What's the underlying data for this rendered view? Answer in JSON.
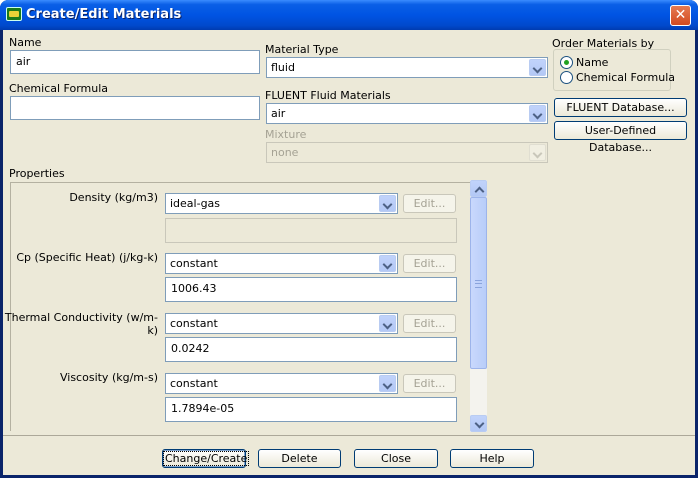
{
  "window": {
    "title": "Create/Edit Materials",
    "close_glyph": "✕"
  },
  "name": {
    "label": "Name",
    "value": "air"
  },
  "chemical_formula": {
    "label": "Chemical Formula",
    "value": ""
  },
  "material_type": {
    "label": "Material Type",
    "value": "fluid"
  },
  "fluent_fluid_materials": {
    "label": "FLUENT Fluid Materials",
    "value": "air"
  },
  "mixture": {
    "label": "Mixture",
    "value": "none"
  },
  "order_materials": {
    "label": "Order Materials by",
    "options": [
      {
        "label": "Name",
        "selected": true
      },
      {
        "label": "Chemical Formula",
        "selected": false
      }
    ]
  },
  "database_buttons": {
    "fluent": "FLUENT Database...",
    "user_defined": "User-Defined Database..."
  },
  "properties": {
    "label": "Properties",
    "edit_label": "Edit...",
    "items": [
      {
        "label": "Density (kg/m3)",
        "method": "ideal-gas",
        "value": ""
      },
      {
        "label": "Cp (Specific Heat) (j/kg-k)",
        "method": "constant",
        "value": "1006.43"
      },
      {
        "label": "Thermal Conductivity (w/m-k)",
        "method": "constant",
        "value": "0.0242"
      },
      {
        "label": "Viscosity (kg/m-s)",
        "method": "constant",
        "value": "1.7894e-05"
      }
    ]
  },
  "footer_buttons": {
    "change_create": "Change/Create",
    "delete": "Delete",
    "close": "Close",
    "help": "Help"
  },
  "icons": {
    "title": "fluent-app-icon",
    "dropdown": "chevron-down-icon",
    "scroll_up": "scroll-up-icon",
    "scroll_down": "scroll-down-icon"
  },
  "colors": {
    "titlebar": "#0054e3",
    "client_bg": "#ece9d8",
    "close_button": "#d24a20",
    "radio_dot": "#21a121",
    "scrollbar_thumb": "#c1d3fb"
  }
}
